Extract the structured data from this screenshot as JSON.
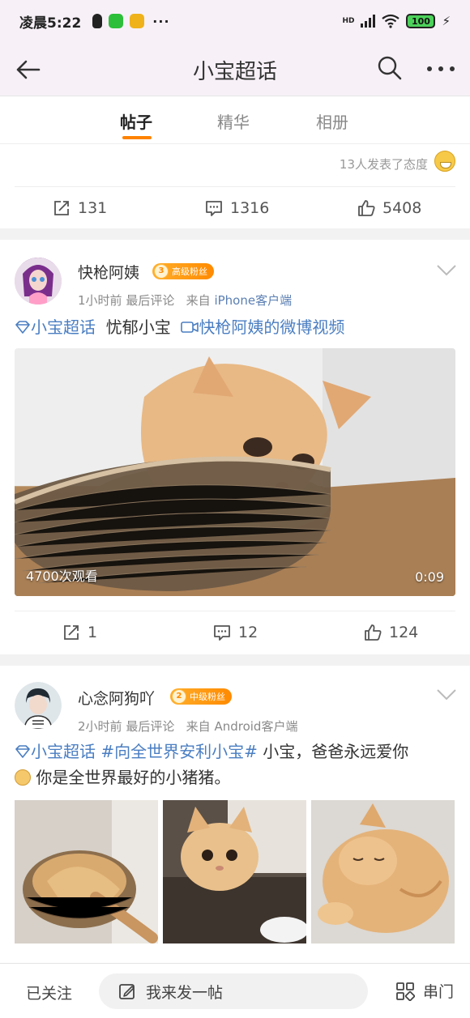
{
  "status_bar": {
    "time": "凌晨5:22",
    "network": "HD",
    "battery": "100",
    "more": "···"
  },
  "nav": {
    "title": "小宝超话"
  },
  "tabs": [
    {
      "label": "帖子",
      "active": true
    },
    {
      "label": "精华",
      "active": false
    },
    {
      "label": "相册",
      "active": false
    }
  ],
  "top_card": {
    "attitude_text": "13人发表了态度",
    "reposts": "131",
    "comments": "1316",
    "likes": "5408"
  },
  "posts": [
    {
      "username": "快枪阿姨",
      "fan_level": "3",
      "fan_badge": "高级粉丝",
      "time": "1小时前",
      "last_comment": "最后评论",
      "source_prefix": "来自",
      "source": "iPhone客户端",
      "supertopic": "小宝超话",
      "text": "忧郁小宝",
      "video_link": "快枪阿姨的微博视频",
      "video_views": "4700次观看",
      "video_duration": "0:09",
      "reposts": "1",
      "comments": "12",
      "likes": "124"
    },
    {
      "username": "心念阿狗吖",
      "fan_level": "2",
      "fan_badge": "中级粉丝",
      "time": "2小时前",
      "last_comment": "最后评论",
      "source_prefix": "来自",
      "source": "Android客户端",
      "supertopic": "小宝超话",
      "hashtag": "#向全世界安利小宝#",
      "text_line1": "小宝，爸爸永远爱你",
      "text_line2": "你是全世界最好的小猪猪。"
    }
  ],
  "bottom_bar": {
    "followed": "已关注",
    "composer": "我来发一帖",
    "chuanmen": "串门"
  },
  "colors": {
    "accent": "#ff8200",
    "link": "#4a7ec2",
    "header_bg": "#f7f1f7"
  },
  "icons": [
    "back-arrow-icon",
    "search-icon",
    "more-icon",
    "repost-icon",
    "comment-icon",
    "like-icon",
    "chevron-down-icon",
    "supertopic-icon",
    "video-icon",
    "compose-icon",
    "grid-icon"
  ]
}
